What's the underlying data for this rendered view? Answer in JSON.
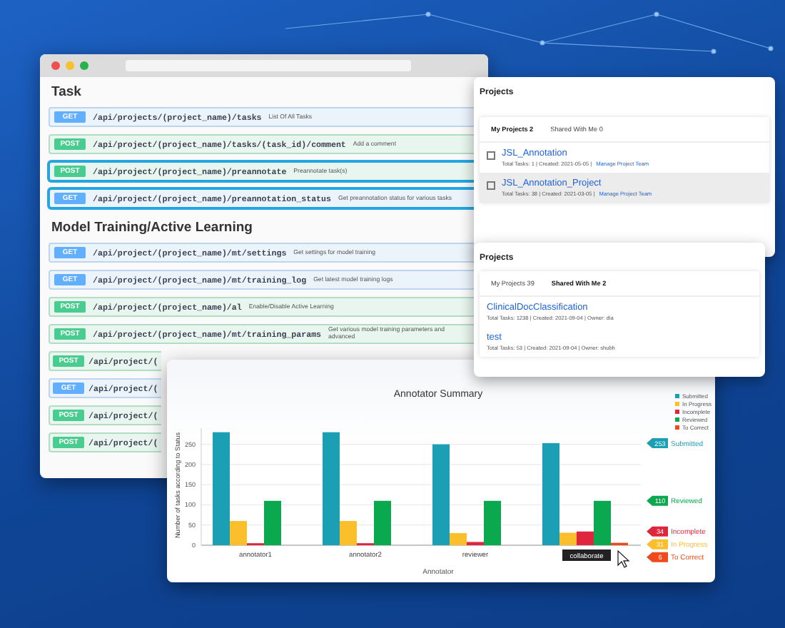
{
  "api_window": {
    "sections": [
      {
        "title": "Task",
        "rows": [
          {
            "kind": "get",
            "method": "GET",
            "path": "/api/projects/(project_name)/tasks",
            "description": "List Of All Tasks",
            "highlighted": false
          },
          {
            "kind": "post",
            "method": "POST",
            "path": "/api/project/(project_name)/tasks/(task_id)/comment",
            "description": "Add a comment",
            "highlighted": false
          },
          {
            "kind": "post",
            "method": "POST",
            "path": "/api/project/(project_name)/preannotate",
            "description": "Preannotate task(s)",
            "highlighted": true
          },
          {
            "kind": "get",
            "method": "GET",
            "path": "/api/project/(project_name)/preannotation_status",
            "description": "Get preannotation status for various tasks",
            "highlighted": true
          }
        ]
      },
      {
        "title": "Model Training/Active Learning",
        "rows": [
          {
            "kind": "get",
            "method": "GET",
            "path": "/api/project/(project_name)/mt/settings",
            "description": "Get settings for model training",
            "highlighted": false
          },
          {
            "kind": "get",
            "method": "GET",
            "path": "/api/project/(project_name)/mt/training_log",
            "description": "Get latest model training logs",
            "highlighted": false
          },
          {
            "kind": "post",
            "method": "POST",
            "path": "/api/project/(project_name)/al",
            "description": "Enable/Disable Active Learning",
            "highlighted": false
          },
          {
            "kind": "post",
            "method": "POST",
            "path": "/api/project/(project_name)/mt/training_params",
            "description": "Get various model training parameters and advanced",
            "highlighted": false
          },
          {
            "kind": "post",
            "method": "POST",
            "path": "/api/project/(",
            "highlighted": false
          },
          {
            "kind": "get",
            "method": "GET",
            "path": "/api/project/(",
            "highlighted": false
          },
          {
            "kind": "post",
            "method": "POST",
            "path": "/api/project/(",
            "highlighted": false
          },
          {
            "kind": "post",
            "method": "POST",
            "path": "/api/project/(",
            "highlighted": false
          }
        ]
      }
    ]
  },
  "project_panels": [
    {
      "title": "Projects",
      "tabs": [
        {
          "label": "My Projects 2",
          "selected": true
        },
        {
          "label": "Shared With Me 0",
          "selected": false
        }
      ],
      "items": [
        {
          "name": "JSL_Annotation",
          "meta": "Total Tasks: 1 | Created: 2021-05-05 |",
          "link": "Manage Project Team",
          "checkbox": true,
          "selected": false
        },
        {
          "name": "JSL_Annotation_Project",
          "meta": "Total Tasks: 38 | Created: 2021-03-05 |",
          "link": "Manage Project Team",
          "checkbox": true,
          "selected": true
        }
      ]
    },
    {
      "title": "Projects",
      "tabs": [
        {
          "label": "My Projects 39",
          "selected": false
        },
        {
          "label": "Shared With Me 2",
          "selected": true
        }
      ],
      "items": [
        {
          "name": "ClinicalDocClassification",
          "meta": "Total Tasks: 1238 | Created: 2021-09-04 | Owner: dia",
          "checkbox": false,
          "selected": false
        },
        {
          "name": "test",
          "meta": "Total Tasks: 53 | Created: 2021-09-04 | Owner: shubh",
          "checkbox": false,
          "selected": false
        }
      ]
    }
  ],
  "chart_window": {
    "tooltip_on_last": true,
    "chart_data": {
      "type": "bar",
      "title": "Annotator Summary",
      "xlabel": "Annotator",
      "ylabel": "Number of tasks according to Status",
      "categories": [
        "annotator1",
        "annotator2",
        "reviewer",
        "collaborate"
      ],
      "series": [
        {
          "name": "Submitted",
          "color": "#1a9fb5",
          "values": [
            280,
            280,
            250,
            253
          ]
        },
        {
          "name": "In Progress",
          "color": "#fbbf2c",
          "values": [
            60,
            60,
            30,
            31
          ]
        },
        {
          "name": "Incomplete",
          "color": "#e0263f",
          "values": [
            5,
            5,
            8,
            34
          ]
        },
        {
          "name": "Reviewed",
          "color": "#0aa84f",
          "values": [
            110,
            110,
            110,
            110
          ]
        },
        {
          "name": "To Correct",
          "color": "#f04a1c",
          "values": [
            0,
            0,
            0,
            6
          ]
        }
      ],
      "ylim": [
        0,
        290
      ],
      "yticks": [
        0,
        50,
        100,
        150,
        200,
        250
      ],
      "grid": true,
      "legend": true,
      "annotations": [
        "253",
        "31",
        "34",
        "110",
        "6"
      ]
    }
  }
}
